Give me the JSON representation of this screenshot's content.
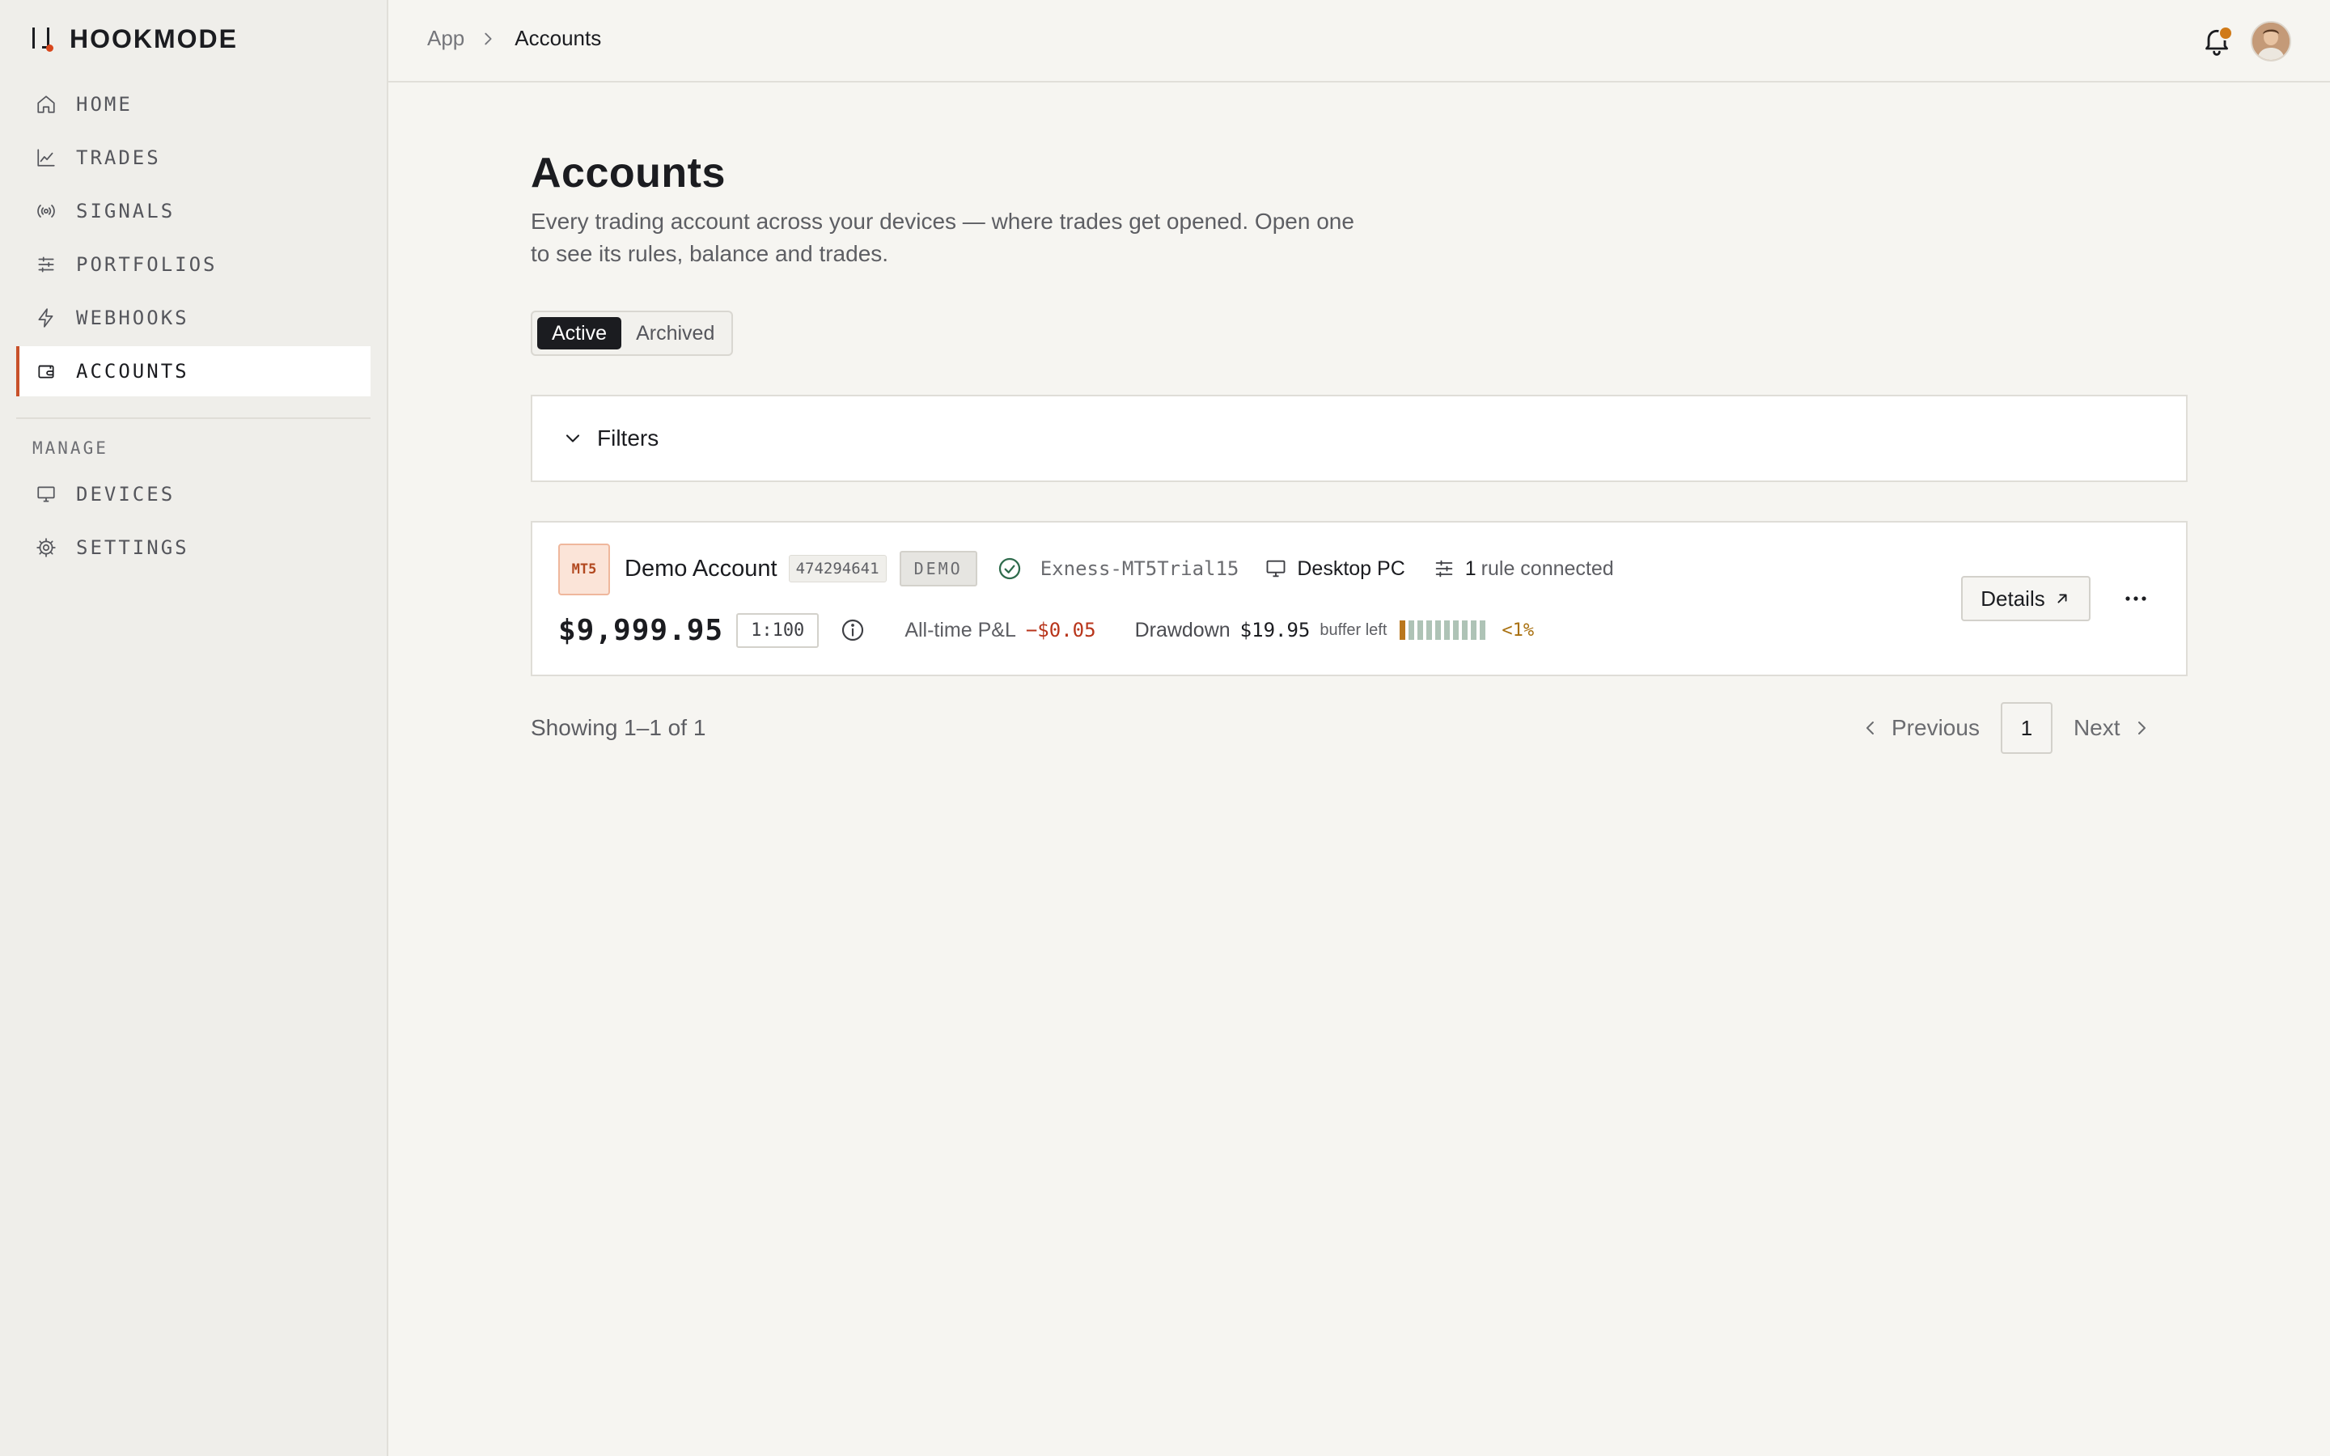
{
  "brand": {
    "name": "HOOKMODE"
  },
  "sidebar": {
    "items": [
      {
        "label": "HOME",
        "icon": "home-icon"
      },
      {
        "label": "TRADES",
        "icon": "chart-line-icon"
      },
      {
        "label": "SIGNALS",
        "icon": "broadcast-icon"
      },
      {
        "label": "PORTFOLIOS",
        "icon": "sliders-icon"
      },
      {
        "label": "WEBHOOKS",
        "icon": "lightning-icon"
      },
      {
        "label": "ACCOUNTS",
        "icon": "wallet-icon",
        "active": true
      }
    ],
    "manage_label": "MANAGE",
    "manage_items": [
      {
        "label": "DEVICES",
        "icon": "monitor-icon"
      },
      {
        "label": "SETTINGS",
        "icon": "gear-icon"
      }
    ]
  },
  "breadcrumb": {
    "root": "App",
    "current": "Accounts"
  },
  "page": {
    "title": "Accounts",
    "subtitle": "Every trading account across your devices — where trades get opened. Open one to see its rules, balance and trades."
  },
  "tabs": {
    "active": "Active",
    "archived": "Archived"
  },
  "filters": {
    "label": "Filters"
  },
  "account": {
    "platform": "MT5",
    "name": "Demo Account",
    "number": "474294641",
    "type_badge": "DEMO",
    "server": "Exness-MT5Trial15",
    "device": "Desktop PC",
    "rules_count": "1",
    "rules_text": "rule connected",
    "balance": "$9,999.95",
    "leverage": "1:100",
    "pnl_label": "All-time P&L",
    "pnl_value": "−$0.05",
    "drawdown_label": "Drawdown",
    "drawdown_value": "$19.95",
    "drawdown_buffer": "buffer left",
    "drawdown_pct": "<1%",
    "drawdown_used_fraction": 0.01,
    "details_label": "Details"
  },
  "pagination": {
    "showing": "Showing 1–1 of 1",
    "previous": "Previous",
    "page": "1",
    "next": "Next"
  },
  "colors": {
    "accent": "#c8512a",
    "loss": "#b8351b",
    "warning": "#a9700f",
    "success": "#2e6b4c"
  }
}
